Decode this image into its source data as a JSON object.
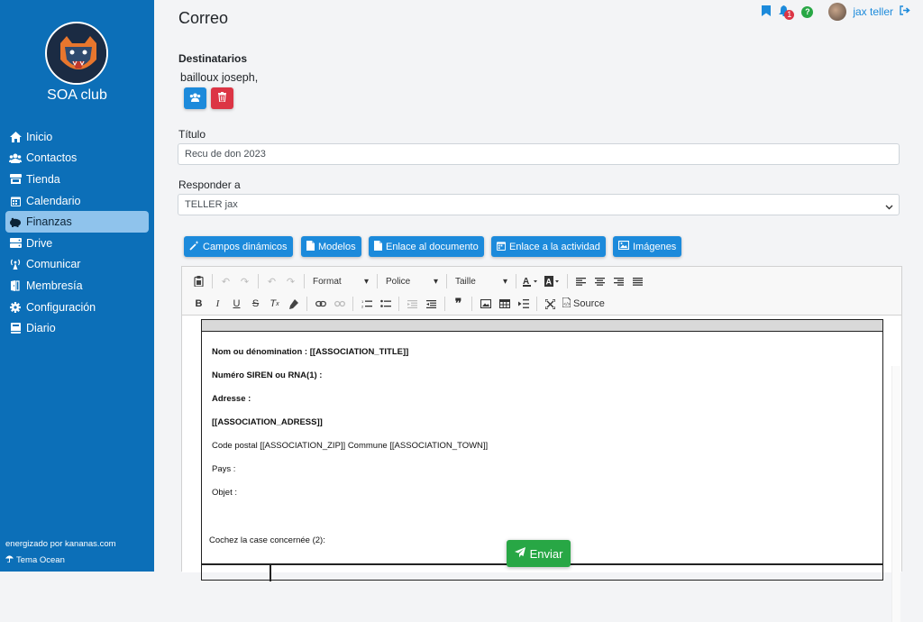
{
  "sidebar": {
    "brand": "SOA club",
    "items": [
      {
        "label": "Inicio",
        "icon": "home-icon"
      },
      {
        "label": "Contactos",
        "icon": "users-icon"
      },
      {
        "label": "Tienda",
        "icon": "store-icon"
      },
      {
        "label": "Calendario",
        "icon": "calendar-icon"
      },
      {
        "label": "Finanzas",
        "icon": "piggy-bank-icon",
        "active": true
      },
      {
        "label": "Drive",
        "icon": "drive-icon"
      },
      {
        "label": "Comunicar",
        "icon": "broadcast-icon"
      },
      {
        "label": "Membresía",
        "icon": "door-icon"
      },
      {
        "label": "Configuración",
        "icon": "gear-icon"
      },
      {
        "label": "Diario",
        "icon": "book-icon"
      }
    ],
    "powered_by": "energizado por kananas.com",
    "theme": "Tema Ocean"
  },
  "header": {
    "title": "Correo",
    "notifications_count": "1",
    "help": "?",
    "username": "jax teller"
  },
  "form": {
    "recipients_label": "Destinatarios",
    "recipients_value": "bailloux joseph,",
    "title_label": "Título",
    "title_value": "Recu de don 2023",
    "reply_label": "Responder a",
    "reply_value": "TELLER jax"
  },
  "actions": {
    "dynamic_fields": "Campos dinámicos",
    "templates": "Modelos",
    "doc_link": "Enlace al documento",
    "activity_link": "Enlace a la actividad",
    "images": "Imágenes"
  },
  "editor": {
    "format": "Format",
    "font": "Police",
    "size": "Taille",
    "source": "Source",
    "lines": [
      {
        "text": "Nom ou dénomination :  [[ASSOCIATION_TITLE]]",
        "bold": true
      },
      {
        "text": "Numéro SIREN ou RNA(1) :",
        "bold": true
      },
      {
        "text": "Adresse :",
        "bold": true
      },
      {
        "text": "[[ASSOCIATION_ADRESS]]",
        "bold": true
      },
      {
        "text": "Code postal [[ASSOCIATION_ZIP]] Commune [[ASSOCIATION_TOWN]]",
        "bold": false
      },
      {
        "text": "Pays :",
        "bold": false
      },
      {
        "text": "Objet :",
        "bold": false
      },
      {
        "text": "Cochez la case concernée (2):",
        "bold": false
      }
    ]
  },
  "send_label": "Enviar",
  "colors": {
    "sidebar": "#0c6fb8",
    "primary": "#1c8adb",
    "danger": "#dc3545",
    "success": "#28a745",
    "active": "#8fc3ec"
  }
}
